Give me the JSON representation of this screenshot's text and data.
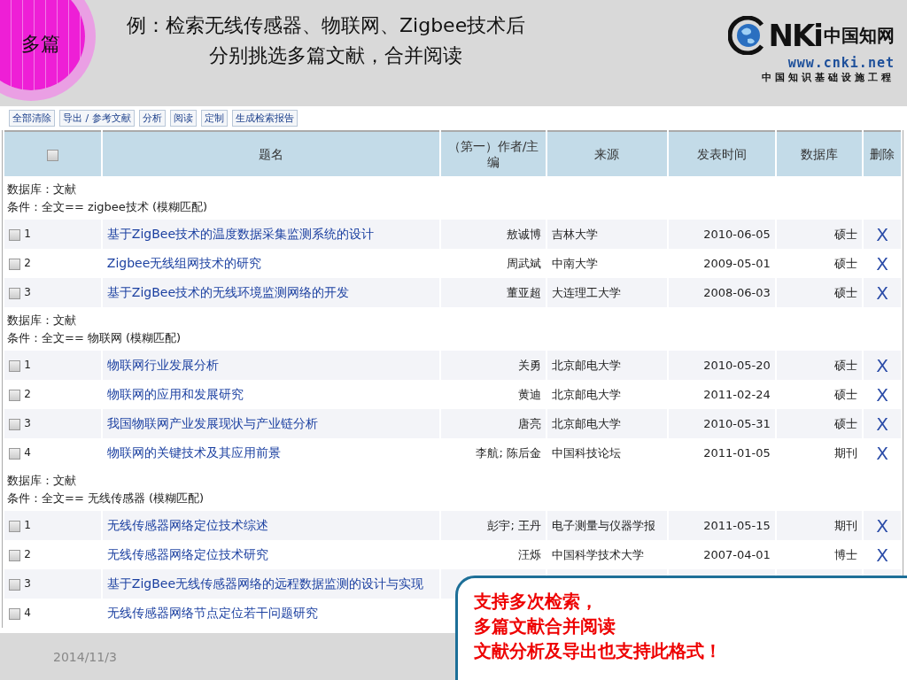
{
  "badge": "多篇",
  "title_lines": [
    "例：检索无线传感器、物联网、Zigbee技术后",
    "分别挑选多篇文献，合并阅读"
  ],
  "logo": {
    "mark": "NKi",
    "chinese_name": "中国知网",
    "url": "www.cnki.net",
    "tagline": "中国知识基础设施工程"
  },
  "toolbar": [
    "全部清除",
    "导出 / 参考文献",
    "分析",
    "阅读",
    "定制",
    "生成检索报告"
  ],
  "table": {
    "select_all_checked": false,
    "columns": [
      "题名",
      "（第一）作者/主编",
      "来源",
      "发表时间",
      "数据库",
      "删除"
    ],
    "groups": [
      {
        "database": "数据库：文献",
        "condition": "条件：全文== zigbee技术 (模糊匹配)",
        "rows": [
          {
            "number": "1",
            "checked": false,
            "title": "基于ZigBee技术的温度数据采集监测系统的设计",
            "author": "敖诚博",
            "source": "吉林大学",
            "date": "2010-06-05",
            "database": "硕士",
            "delete": "X"
          },
          {
            "number": "2",
            "checked": false,
            "title": "Zigbee无线组网技术的研究",
            "author": "周武斌",
            "source": "中南大学",
            "date": "2009-05-01",
            "database": "硕士",
            "delete": "X"
          },
          {
            "number": "3",
            "checked": false,
            "title": "基于ZigBee技术的无线环境监测网络的开发",
            "author": "董亚超",
            "source": "大连理工大学",
            "date": "2008-06-03",
            "database": "硕士",
            "delete": "X"
          }
        ]
      },
      {
        "database": "数据库：文献",
        "condition": "条件：全文== 物联网 (模糊匹配)",
        "rows": [
          {
            "number": "1",
            "checked": false,
            "title": "物联网行业发展分析",
            "author": "关勇",
            "source": "北京邮电大学",
            "date": "2010-05-20",
            "database": "硕士",
            "delete": "X"
          },
          {
            "number": "2",
            "checked": false,
            "title": "物联网的应用和发展研究",
            "author": "黄迪",
            "source": "北京邮电大学",
            "date": "2011-02-24",
            "database": "硕士",
            "delete": "X"
          },
          {
            "number": "3",
            "checked": false,
            "title": "我国物联网产业发展现状与产业链分析",
            "author": "唐亮",
            "source": "北京邮电大学",
            "date": "2010-05-31",
            "database": "硕士",
            "delete": "X"
          },
          {
            "number": "4",
            "checked": false,
            "title": "物联网的关键技术及其应用前景",
            "author": "李航; 陈后金",
            "source": "中国科技论坛",
            "date": "2011-01-05",
            "database": "期刊",
            "delete": "X"
          }
        ]
      },
      {
        "database": "数据库：文献",
        "condition": "条件：全文== 无线传感器 (模糊匹配)",
        "rows": [
          {
            "number": "1",
            "checked": false,
            "title": "无线传感器网络定位技术综述",
            "author": "彭宇; 王丹",
            "source": "电子测量与仪器学报",
            "date": "2011-05-15",
            "database": "期刊",
            "delete": "X"
          },
          {
            "number": "2",
            "checked": false,
            "title": "无线传感器网络定位技术研究",
            "author": "汪烁",
            "source": "中国科学技术大学",
            "date": "2007-04-01",
            "database": "博士",
            "delete": "X"
          },
          {
            "number": "3",
            "checked": false,
            "title": "基于ZigBee无线传感器网络的远程数据监测的设计与实现"
          },
          {
            "number": "4",
            "checked": false,
            "title": "无线传感器网络节点定位若干问题研究"
          }
        ]
      }
    ]
  },
  "footer_date": "2014/11/3",
  "callout": [
    "支持多次检索，",
    "多篇文献合并阅读",
    "文献分析及导出也支持此格式！"
  ]
}
